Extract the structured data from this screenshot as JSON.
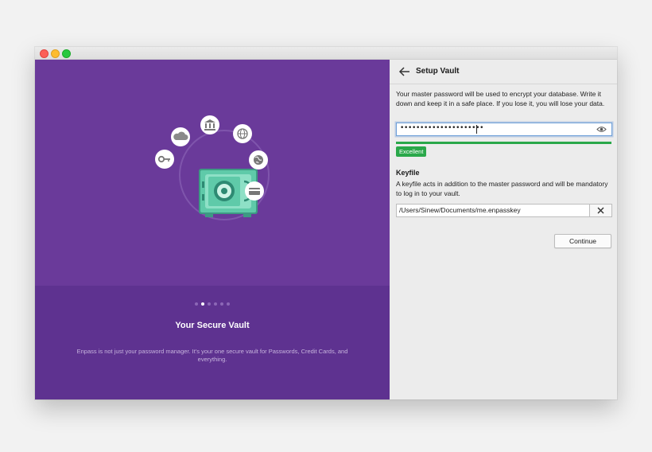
{
  "window": {
    "traffic_lights": [
      "close",
      "minimize",
      "zoom"
    ]
  },
  "onboarding": {
    "slide_title": "Your Secure Vault",
    "slide_description": "Enpass is not just your password manager. It's your one secure vault for Passwords, Credit Cards, and everything.",
    "pager": {
      "total": 6,
      "active_index": 1
    },
    "illustration_icons": [
      "cloud-icon",
      "bank-icon",
      "globe-icon",
      "key-icon",
      "world-icon",
      "credit-card-icon",
      "safe-icon"
    ],
    "colors": {
      "background": "#6a3a9a",
      "bottom_panel": "#5e3290",
      "safe": "#5fcaa9"
    }
  },
  "setup": {
    "title": "Setup Vault",
    "info_text": "Your master password will be used to encrypt your database. Write it down and keep it in a safe place. If you lose it, you will lose your data.",
    "password_mask": "•••••••••••••••••••••",
    "strength_label": "Excellent",
    "strength_fraction": 1.0,
    "strength_color": "#2aa84a",
    "keyfile_title": "Keyfile",
    "keyfile_description": "A keyfile acts in addition to the master password and will be mandatory to log in to your vault.",
    "keyfile_path": "/Users/Sinew/Documents/me.enpasskey",
    "continue_label": "Continue"
  }
}
